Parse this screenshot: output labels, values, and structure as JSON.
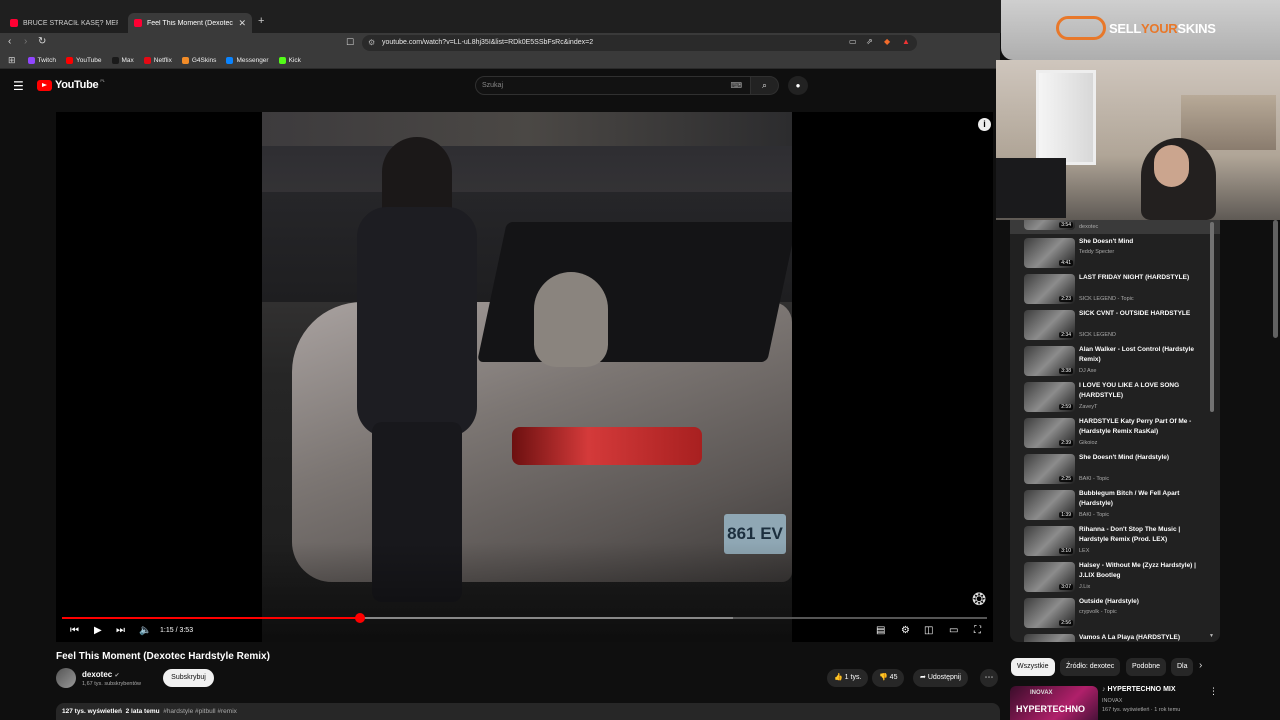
{
  "browser": {
    "tabs": [
      {
        "title": "BRUCE STRACIŁ KASĘ? MERGHANI D"
      },
      {
        "title": "Feel This Moment (Dexotec Hard"
      }
    ],
    "url": "youtube.com/watch?v=LL-uL8hj35I&list=RDk0E5SSbFsRc&index=2",
    "bookmarks": [
      {
        "label": "Twitch",
        "color": "#9146ff"
      },
      {
        "label": "YouTube",
        "color": "#ff0000"
      },
      {
        "label": "Max",
        "color": "#1a1a1a"
      },
      {
        "label": "Netflix",
        "color": "#e50914"
      },
      {
        "label": "G4Skins",
        "color": "#f28c28"
      },
      {
        "label": "Messenger",
        "color": "#0a84ff"
      },
      {
        "label": "Kick",
        "color": "#53fc18"
      }
    ]
  },
  "youtube": {
    "logo_text": "YouTube",
    "region": "PL",
    "search_placeholder": "Szukaj"
  },
  "player": {
    "current_time": "1:15",
    "duration": "3:53",
    "progress_fraction": 0.3219,
    "buffered_fraction": 0.725,
    "plate_text": "861 EV"
  },
  "video": {
    "title": "Feel This Moment (Dexotec Hardstyle Remix)",
    "channel": "dexotec",
    "subscribers": "1,67 tys. subskrybentów",
    "subscribe_label": "Subskrybuj",
    "likes": "1 tys.",
    "dislikes": "45",
    "share_label": "Udostępnij",
    "views": "127 tys. wyświetleń",
    "age": "2 lata temu",
    "tags": "#hardstyle #pitbull #remix"
  },
  "sponsor": {
    "text_a": "SELL",
    "text_b": "YOUR",
    "text_c": "SKINS",
    "accent": "#e8782a"
  },
  "playlist": {
    "current": {
      "duration": "3:54",
      "channel": "dexotec"
    },
    "items": [
      {
        "title": "She Doesn't Mind",
        "channel": "Teddy Specter",
        "duration": "4:41"
      },
      {
        "title": "LAST FRIDAY NIGHT (HARDSTYLE)",
        "channel": "SICK LEGEND - Topic",
        "duration": "2:23"
      },
      {
        "title": "SICK CVNT - OUTSIDE HARDSTYLE",
        "channel": "SICK LEGEND",
        "duration": "2:34"
      },
      {
        "title": "Alan Walker - Lost Control (Hardstyle Remix)",
        "channel": "DJ Axe",
        "duration": "3:38"
      },
      {
        "title": "I LOVE YOU LIKE A LOVE SONG (HARDSTYLE)",
        "channel": "ZaveyT",
        "duration": "2:59"
      },
      {
        "title": "HARDSTYLE Katy Perry Part Of Me - (Hardstyle Remix RasKal)",
        "channel": "Gikoioz",
        "duration": "2:39"
      },
      {
        "title": "She Doesn't Mind (Hardstyle)",
        "channel": "BAKI - Topic",
        "duration": "2:25"
      },
      {
        "title": "Bubblegum Bitch / We Fell Apart (Hardstyle)",
        "channel": "BAKI - Topic",
        "duration": "1:39"
      },
      {
        "title": "Rihanna - Don't Stop The Music | Hardstyle Remix (Prod. LEX)",
        "channel": "LEX",
        "duration": "3:10"
      },
      {
        "title": "Halsey - Without Me (Zyzz Hardstyle) | J.LIX Bootleg",
        "channel": "J.Lix",
        "duration": "3:07"
      },
      {
        "title": "Outside (Hardstyle)",
        "channel": "crypvolk - Topic",
        "duration": "2:56"
      },
      {
        "title": "Vamos A La Playa (HARDSTYLE)",
        "channel": "",
        "duration": "2:??"
      }
    ]
  },
  "chips": [
    "Wszystkie",
    "Źródło: dexotec",
    "Podobne",
    "Dla"
  ],
  "recommended": {
    "title": "HYPERTECHNO MIX",
    "channel": "INOVAX",
    "meta": "167 tys. wyświetleń · 1 rok temu",
    "thumb_top": "INOVAX",
    "thumb_text": "HYPERTECHNO"
  }
}
